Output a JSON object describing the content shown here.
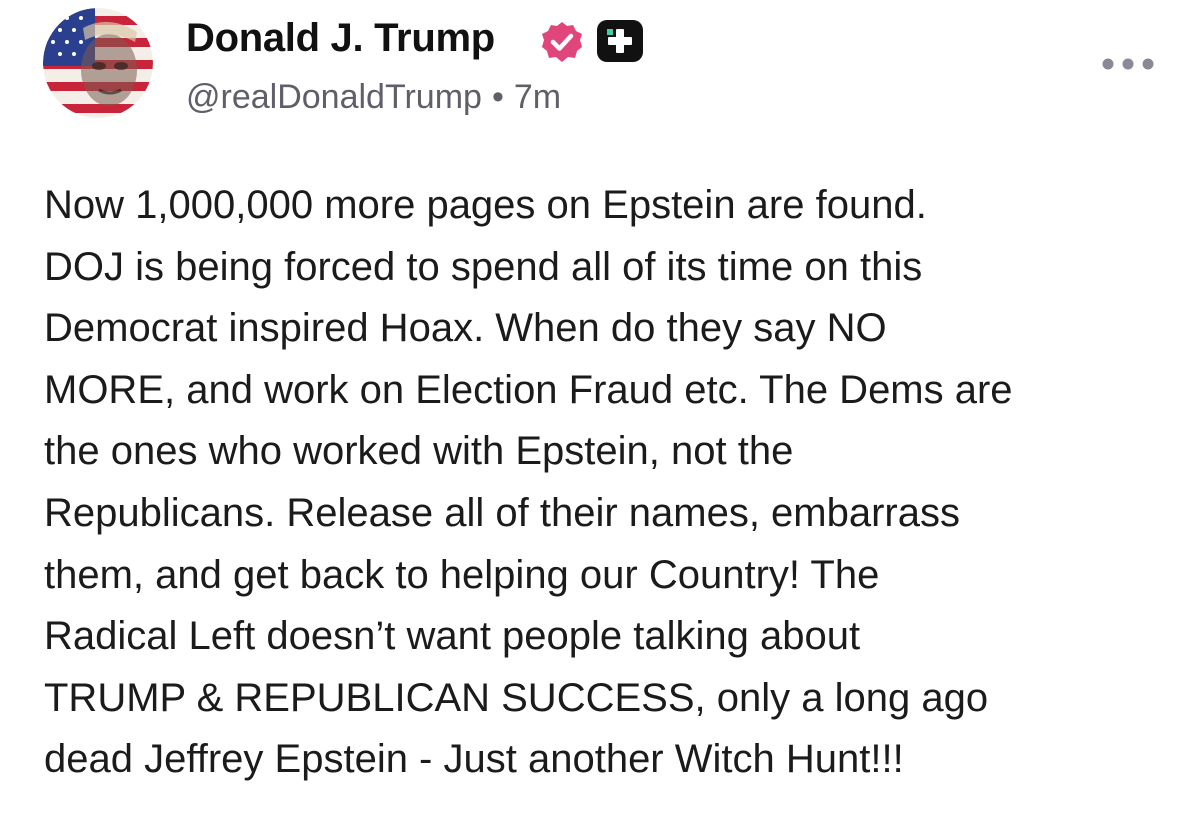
{
  "author": {
    "display_name": "Donald J. Trump",
    "handle": "@realDonaldTrump",
    "separator": "•",
    "time_ago": "7m",
    "avatar_icon": "flag-portrait-avatar",
    "verified_icon": "verified-badge-icon",
    "plus_icon": "plus-badge-icon"
  },
  "menu": {
    "icon": "more-options-icon"
  },
  "post": {
    "lines": [
      "Now 1,000,000 more pages on Epstein are found.",
      "DOJ is being forced to spend all of its time on this",
      "Democrat inspired Hoax. When do they say NO",
      "MORE, and work on Election Fraud etc. The Dems are",
      "the ones who worked with Epstein, not the",
      "Republicans. Release all of their names, embarrass",
      "them, and get back to helping our Country! The",
      "Radical Left doesn’t want people talking about",
      "TRUMP & REPUBLICAN SUCCESS, only a long ago",
      "dead Jeffrey Epstein - Just another Witch Hunt!!!"
    ]
  },
  "colors": {
    "badge_pink": "#e0457b",
    "badge_dark": "#111111",
    "handle_gray": "#5f5f6a",
    "more_gray": "#8a8a96"
  }
}
